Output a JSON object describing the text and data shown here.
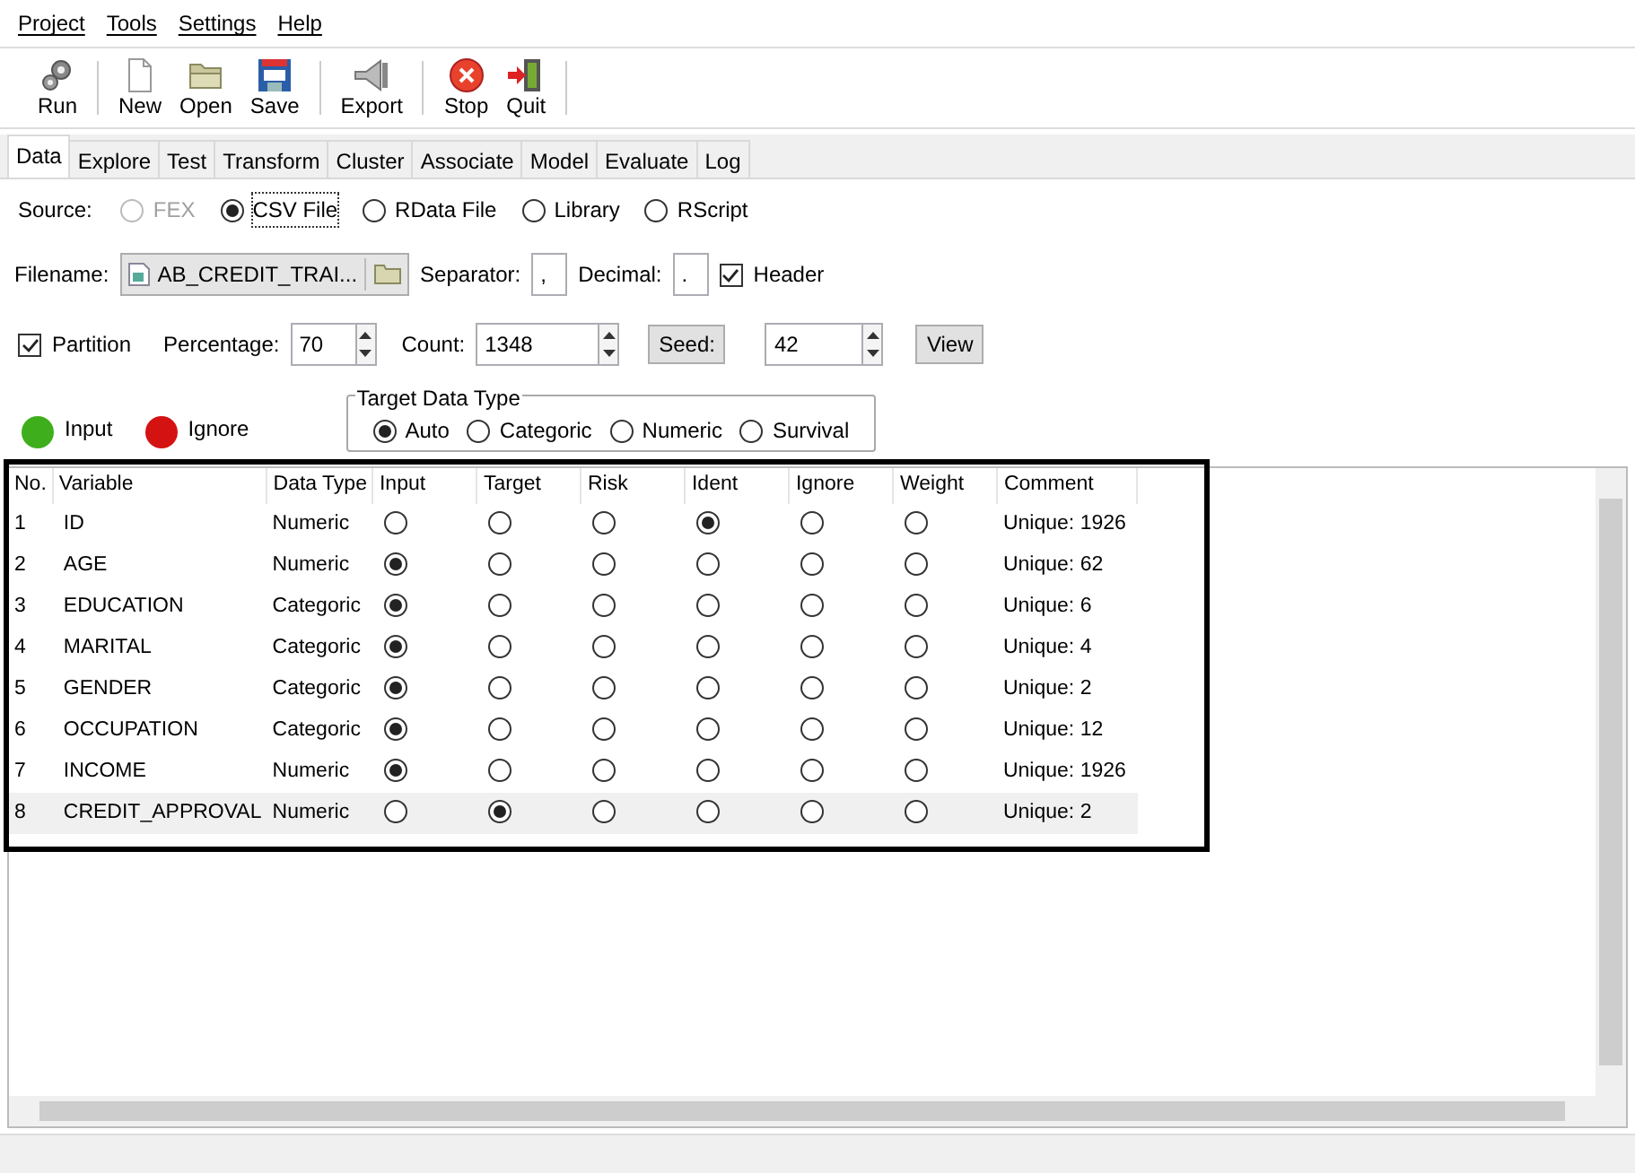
{
  "menu": [
    "Project",
    "Tools",
    "Settings",
    "Help"
  ],
  "toolbar": [
    {
      "label": "Run",
      "kind": "run"
    },
    {
      "label": "New",
      "kind": "new"
    },
    {
      "label": "Open",
      "kind": "open"
    },
    {
      "label": "Save",
      "kind": "save"
    },
    {
      "label": "Export",
      "kind": "export"
    },
    {
      "label": "Stop",
      "kind": "stop"
    },
    {
      "label": "Quit",
      "kind": "quit"
    }
  ],
  "tabs": [
    {
      "label": "Data",
      "selected": true
    },
    {
      "label": "Explore",
      "selected": false
    },
    {
      "label": "Test",
      "selected": false
    },
    {
      "label": "Transform",
      "selected": false
    },
    {
      "label": "Cluster",
      "selected": false
    },
    {
      "label": "Associate",
      "selected": false
    },
    {
      "label": "Model",
      "selected": false
    },
    {
      "label": "Evaluate",
      "selected": false
    },
    {
      "label": "Log",
      "selected": false
    }
  ],
  "source": {
    "label": "Source:",
    "options": [
      {
        "label": "FEX",
        "selected": false,
        "disabled": true
      },
      {
        "label": "CSV File",
        "selected": true,
        "disabled": false
      },
      {
        "label": "RData File",
        "selected": false,
        "disabled": false
      },
      {
        "label": "Library",
        "selected": false,
        "disabled": false
      },
      {
        "label": "RScript",
        "selected": false,
        "disabled": false
      }
    ]
  },
  "file": {
    "label": "Filename:",
    "value": "AB_CREDIT_TRAI...",
    "separator_label": "Separator:",
    "separator": ",",
    "decimal_label": "Decimal:",
    "decimal": ".",
    "header": {
      "label": "Header",
      "checked": true
    }
  },
  "partition": {
    "label": "Partition",
    "checked": true,
    "percentage_label": "Percentage:",
    "percentage": "70",
    "count_label": "Count:",
    "count": "1348",
    "seed_button": "Seed:",
    "seed": "42",
    "view_button": "View"
  },
  "legend": [
    {
      "label": "Input",
      "color": "#3fae1c"
    },
    {
      "label": "Ignore",
      "color": "#d41212"
    }
  ],
  "target_type": {
    "title": "Target Data Type",
    "options": [
      {
        "label": "Auto",
        "selected": true
      },
      {
        "label": "Categoric",
        "selected": false
      },
      {
        "label": "Numeric",
        "selected": false
      },
      {
        "label": "Survival",
        "selected": false
      }
    ]
  },
  "table": {
    "columns": [
      "No.",
      "Variable",
      "Data Type",
      "Input",
      "Target",
      "Risk",
      "Ident",
      "Ignore",
      "Weight",
      "Comment"
    ],
    "rows": [
      {
        "no": "1",
        "variable": "ID",
        "data_type": "Numeric",
        "roles": [
          false,
          false,
          false,
          true,
          false,
          false
        ],
        "comment": "Unique: 1926",
        "selected": false
      },
      {
        "no": "2",
        "variable": "AGE",
        "data_type": "Numeric",
        "roles": [
          true,
          false,
          false,
          false,
          false,
          false
        ],
        "comment": "Unique: 62",
        "selected": false
      },
      {
        "no": "3",
        "variable": "EDUCATION",
        "data_type": "Categoric",
        "roles": [
          true,
          false,
          false,
          false,
          false,
          false
        ],
        "comment": "Unique: 6",
        "selected": false
      },
      {
        "no": "4",
        "variable": "MARITAL",
        "data_type": "Categoric",
        "roles": [
          true,
          false,
          false,
          false,
          false,
          false
        ],
        "comment": "Unique: 4",
        "selected": false
      },
      {
        "no": "5",
        "variable": "GENDER",
        "data_type": "Categoric",
        "roles": [
          true,
          false,
          false,
          false,
          false,
          false
        ],
        "comment": "Unique: 2",
        "selected": false
      },
      {
        "no": "6",
        "variable": "OCCUPATION",
        "data_type": "Categoric",
        "roles": [
          true,
          false,
          false,
          false,
          false,
          false
        ],
        "comment": "Unique: 12",
        "selected": false
      },
      {
        "no": "7",
        "variable": "INCOME",
        "data_type": "Numeric",
        "roles": [
          true,
          false,
          false,
          false,
          false,
          false
        ],
        "comment": "Unique: 1926",
        "selected": false
      },
      {
        "no": "8",
        "variable": "CREDIT_APPROVAL",
        "data_type": "Numeric",
        "roles": [
          false,
          true,
          false,
          false,
          false,
          false
        ],
        "comment": "Unique: 2",
        "selected": true
      }
    ]
  }
}
